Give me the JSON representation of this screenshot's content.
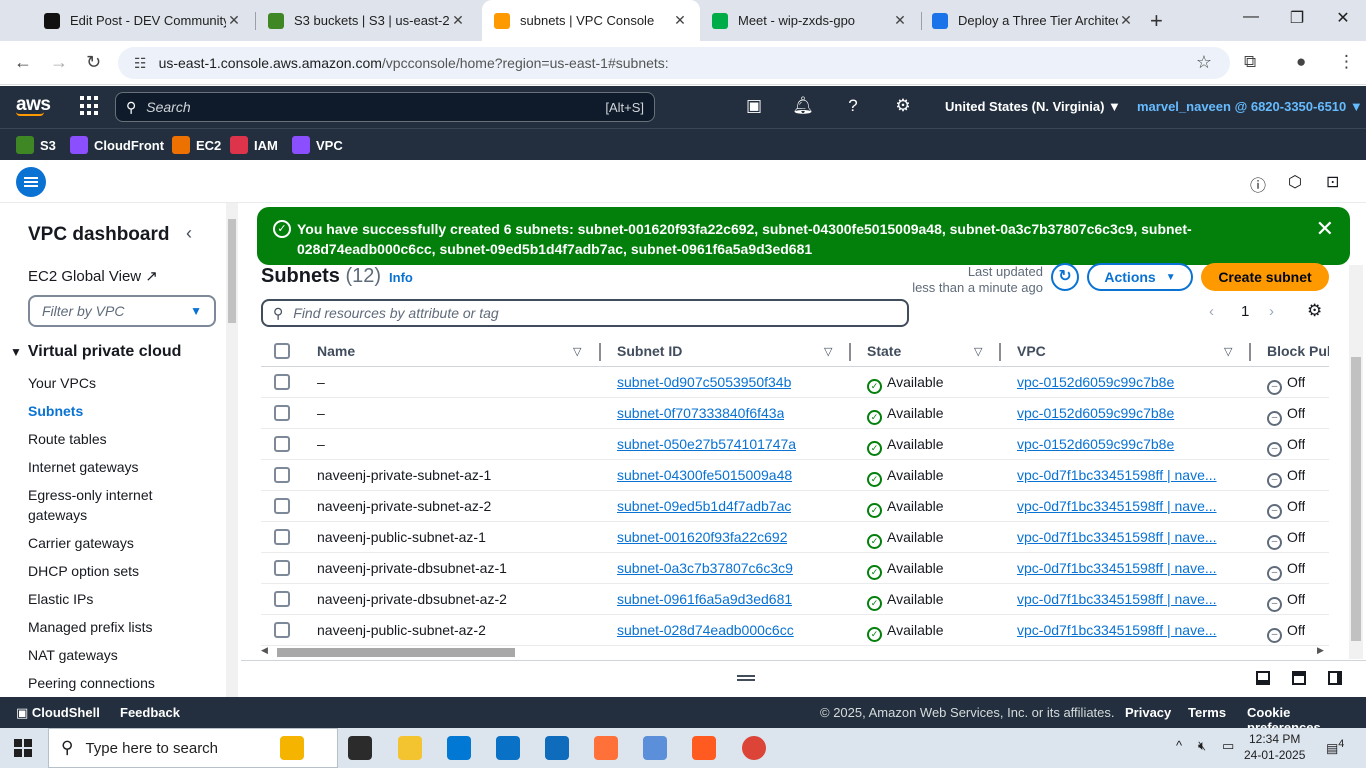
{
  "browser": {
    "tabs": [
      {
        "title": "Edit Post - DEV Community",
        "fav": "#111111"
      },
      {
        "title": "S3 buckets | S3 | us-east-2",
        "fav": "#3f8624"
      },
      {
        "title": "subnets | VPC Console",
        "fav": "#ff9900"
      },
      {
        "title": "Meet - wip-zxds-gpo",
        "fav": "#00ac47"
      },
      {
        "title": "Deploy a Three Tier Architec",
        "fav": "#1a73e8"
      }
    ],
    "url_host": "us-east-1.console.aws.amazon.com",
    "url_path": "/vpcconsole/home?region=us-east-1#subnets:"
  },
  "aws_nav": {
    "logo": "aws",
    "search_placeholder": "Search",
    "search_shortcut": "[Alt+S]",
    "region": "United States (N. Virginia) ▼",
    "account": "marvel_naveen @ 6820-3350-6510 ▼"
  },
  "favorites": [
    {
      "label": "S3",
      "color": "#3f8624"
    },
    {
      "label": "CloudFront",
      "color": "#8c4fff"
    },
    {
      "label": "EC2",
      "color": "#ed7100"
    },
    {
      "label": "IAM",
      "color": "#dd344c"
    },
    {
      "label": "VPC",
      "color": "#8c4fff"
    }
  ],
  "sidebar": {
    "title": "VPC dashboard",
    "global_view": "EC2 Global View",
    "filter_placeholder": "Filter by VPC",
    "section": "Virtual private cloud",
    "items": [
      "Your VPCs",
      "Subnets",
      "Route tables",
      "Internet gateways",
      "Egress-only internet gateways",
      "Carrier gateways",
      "DHCP option sets",
      "Elastic IPs",
      "Managed prefix lists",
      "NAT gateways",
      "Peering connections"
    ],
    "active_index": 1
  },
  "flash": {
    "message": "You have successfully created 6 subnets: subnet-001620f93fa22c692, subnet-04300fe5015009a48, subnet-0a3c7b37807c6c3c9, subnet-028d74eadb000c6cc, subnet-09ed5b1d4f7adb7ac, subnet-0961f6a5a9d3ed681"
  },
  "page": {
    "title": "Subnets",
    "count": "(12)",
    "info": "Info",
    "last_updated_1": "Last updated",
    "last_updated_2": "less than a minute ago",
    "actions": "Actions",
    "create": "Create subnet",
    "search_placeholder": "Find resources by attribute or tag",
    "page_num": "1"
  },
  "table": {
    "columns": [
      "Name",
      "Subnet ID",
      "State",
      "VPC",
      "Block Pub"
    ],
    "rows": [
      {
        "name": "–",
        "id": "subnet-0d907c5053950f34b",
        "state": "Available",
        "vpc": "vpc-0152d6059c99c7b8e",
        "block": "Off"
      },
      {
        "name": "–",
        "id": "subnet-0f707333840f6f43a",
        "state": "Available",
        "vpc": "vpc-0152d6059c99c7b8e",
        "block": "Off"
      },
      {
        "name": "–",
        "id": "subnet-050e27b574101747a",
        "state": "Available",
        "vpc": "vpc-0152d6059c99c7b8e",
        "block": "Off"
      },
      {
        "name": "naveenj-private-subnet-az-1",
        "id": "subnet-04300fe5015009a48",
        "state": "Available",
        "vpc": "vpc-0d7f1bc33451598ff | nave...",
        "block": "Off"
      },
      {
        "name": "naveenj-private-subnet-az-2",
        "id": "subnet-09ed5b1d4f7adb7ac",
        "state": "Available",
        "vpc": "vpc-0d7f1bc33451598ff | nave...",
        "block": "Off"
      },
      {
        "name": "naveenj-public-subnet-az-1",
        "id": "subnet-001620f93fa22c692",
        "state": "Available",
        "vpc": "vpc-0d7f1bc33451598ff | nave...",
        "block": "Off"
      },
      {
        "name": "naveenj-private-dbsubnet-az-1",
        "id": "subnet-0a3c7b37807c6c3c9",
        "state": "Available",
        "vpc": "vpc-0d7f1bc33451598ff | nave...",
        "block": "Off"
      },
      {
        "name": "naveenj-private-dbsubnet-az-2",
        "id": "subnet-0961f6a5a9d3ed681",
        "state": "Available",
        "vpc": "vpc-0d7f1bc33451598ff | nave...",
        "block": "Off"
      },
      {
        "name": "naveenj-public-subnet-az-2",
        "id": "subnet-028d74eadb000c6cc",
        "state": "Available",
        "vpc": "vpc-0d7f1bc33451598ff | nave...",
        "block": "Off"
      }
    ]
  },
  "footer": {
    "cloudshell": "CloudShell",
    "feedback": "Feedback",
    "copyright": "© 2025, Amazon Web Services, Inc. or its affiliates.",
    "privacy": "Privacy",
    "terms": "Terms",
    "cookies": "Cookie preferences"
  },
  "taskbar": {
    "search_placeholder": "Type here to search",
    "time": "12:34 PM",
    "date": "24-01-2025",
    "notif_count": "4",
    "apps": [
      "#f4b400",
      "#2b2b2b",
      "#f4c430",
      "#0078d4",
      "#0a72c6",
      "#0f6cbd",
      "#ff7139",
      "#5b8fd9",
      "#ff5a1f",
      "#db4437"
    ]
  }
}
